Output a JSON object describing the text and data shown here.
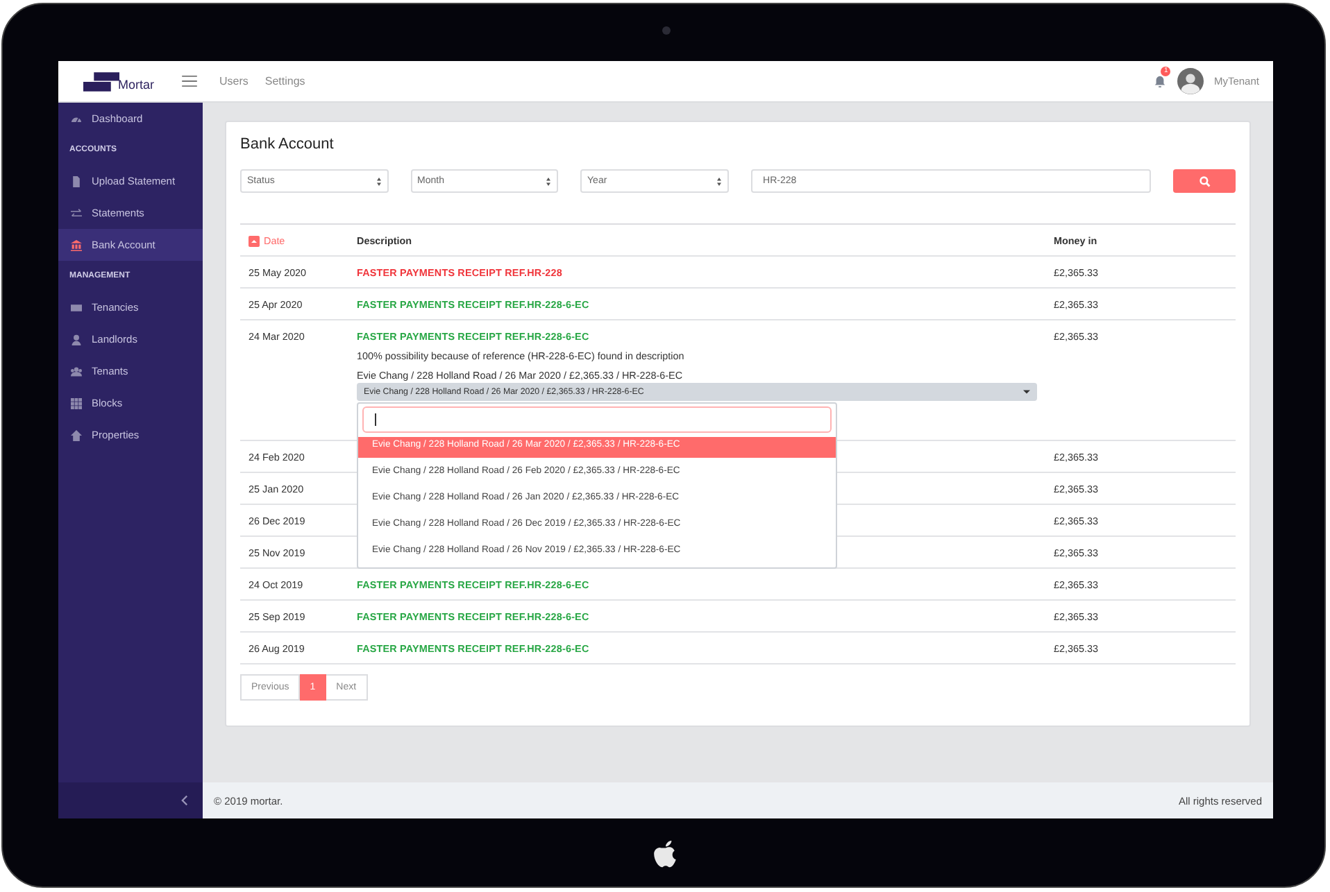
{
  "topbar": {
    "logo": "Mortar",
    "nav": [
      "Users",
      "Settings"
    ],
    "notifications": "1",
    "user": "MyTenant"
  },
  "sidebar": {
    "items": [
      {
        "kind": "link",
        "label": "Dashboard",
        "selected": false
      },
      {
        "kind": "heading",
        "label": "ACCOUNTS"
      },
      {
        "kind": "link",
        "label": "Upload Statement",
        "selected": false
      },
      {
        "kind": "link",
        "label": "Statements",
        "selected": false
      },
      {
        "kind": "link",
        "label": "Bank Account",
        "selected": true
      },
      {
        "kind": "heading",
        "label": "MANAGEMENT"
      },
      {
        "kind": "link",
        "label": "Tenancies",
        "selected": false
      },
      {
        "kind": "link",
        "label": "Landlords",
        "selected": false
      },
      {
        "kind": "link",
        "label": "Tenants",
        "selected": false
      },
      {
        "kind": "link",
        "label": "Blocks",
        "selected": false
      },
      {
        "kind": "link",
        "label": "Properties",
        "selected": false
      }
    ]
  },
  "page": {
    "title": "Bank Account",
    "filters": [
      {
        "kind": "select",
        "value": "Status"
      },
      {
        "kind": "select",
        "value": "Month"
      },
      {
        "kind": "select",
        "value": "Year"
      },
      {
        "kind": "text",
        "value": "HR-228"
      }
    ],
    "table": {
      "columns": [
        {
          "label": "Date",
          "sorted": true
        },
        {
          "label": "Description",
          "sorted": false
        },
        {
          "label": "Money in",
          "sorted": false
        }
      ],
      "rows": [
        {
          "date": "25 May 2020",
          "description": "FASTER PAYMENTS RECEIPT REF.HR-228",
          "matched": false,
          "money": "£2,365.33"
        },
        {
          "date": "25 Apr 2020",
          "description": "FASTER PAYMENTS RECEIPT REF.HR-228-6-EC",
          "matched": true,
          "money": "£2,365.33"
        },
        {
          "date": "24 Mar 2020",
          "description": "FASTER PAYMENTS RECEIPT REF.HR-228-6-EC",
          "matched": true,
          "money": "£2,365.33",
          "note": "100% possibility because of reference (HR-228-6-EC) found in description",
          "match": "Evie Chang / 228 Holland Road / 26 Mar 2020 / £2,365.33 / HR-228-6-EC",
          "selection": "Evie Chang / 228 Holland Road / 26 Mar 2020 / £2,365.33 / HR-228-6-EC",
          "options": [
            {
              "label": "Evie Chang / 228 Holland Road / 26 Mar 2020 / £2,365.33 / HR-228-6-EC",
              "selected": true
            },
            {
              "label": "Evie Chang / 228 Holland Road / 26 Feb 2020 / £2,365.33 / HR-228-6-EC",
              "selected": false
            },
            {
              "label": "Evie Chang / 228 Holland Road / 26 Jan 2020 / £2,365.33 / HR-228-6-EC",
              "selected": false
            },
            {
              "label": "Evie Chang / 228 Holland Road / 26 Dec 2019 / £2,365.33 / HR-228-6-EC",
              "selected": false
            },
            {
              "label": "Evie Chang / 228 Holland Road / 26 Nov 2019 / £2,365.33 / HR-228-6-EC",
              "selected": false
            }
          ]
        },
        {
          "date": "24 Feb 2020",
          "money": "£2,365.33"
        },
        {
          "date": "25 Jan 2020",
          "money": "£2,365.33"
        },
        {
          "date": "26 Dec 2019",
          "money": "£2,365.33"
        },
        {
          "date": "25 Nov 2019",
          "money": "£2,365.33"
        },
        {
          "date": "24 Oct 2019",
          "description": "FASTER PAYMENTS RECEIPT REF.HR-228-6-EC",
          "matched": true,
          "money": "£2,365.33"
        },
        {
          "date": "25 Sep 2019",
          "description": "FASTER PAYMENTS RECEIPT REF.HR-228-6-EC",
          "matched": true,
          "money": "£2,365.33"
        },
        {
          "date": "26 Aug 2019",
          "description": "FASTER PAYMENTS RECEIPT REF.HR-228-6-EC",
          "matched": true,
          "money": "£2,365.33"
        }
      ]
    },
    "pagination": [
      {
        "label": "Previous",
        "selected": false
      },
      {
        "label": "1",
        "selected": true
      },
      {
        "label": "Next",
        "selected": false
      }
    ]
  },
  "footer": {
    "copyright": "© 2019 mortar.",
    "rights": "All rights reserved"
  }
}
